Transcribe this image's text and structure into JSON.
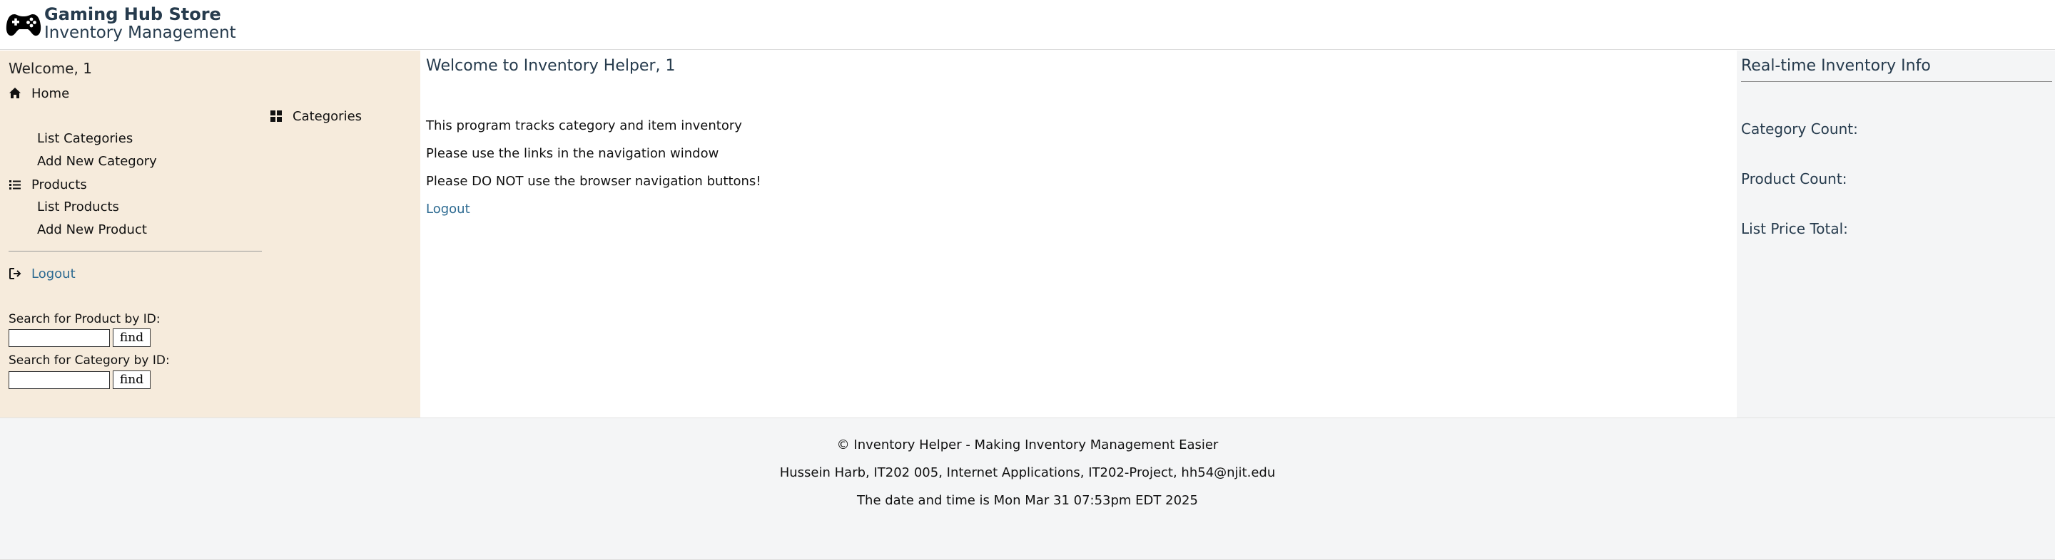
{
  "header": {
    "title": "Gaming Hub Store",
    "subtitle": "Inventory Management",
    "logo_icon": "gamepad-icon"
  },
  "sidebar": {
    "welcome": "Welcome, 1",
    "home": {
      "label": "Home",
      "icon": "home-icon"
    },
    "categories": {
      "label": "Categories",
      "icon": "grid-icon",
      "items": [
        "List Categories",
        "Add New Category"
      ]
    },
    "products": {
      "label": "Products",
      "icon": "list-icon",
      "items": [
        "List Products",
        "Add New Product"
      ]
    },
    "logout": {
      "label": "Logout",
      "icon": "logout-icon"
    },
    "search_product": {
      "label": "Search for Product by ID:",
      "value": "",
      "button": "find"
    },
    "search_category": {
      "label": "Search for Category by ID:",
      "value": "",
      "button": "find"
    }
  },
  "main": {
    "title": "Welcome to Inventory Helper, 1",
    "paragraphs": [
      "This program tracks category and item inventory",
      "Please use the links in the navigation window",
      "Please DO NOT use the browser navigation buttons!"
    ],
    "logout": "Logout"
  },
  "right_panel": {
    "title": "Real-time Inventory Info",
    "stats": [
      "Category Count:",
      "Product Count:",
      "List Price Total:"
    ]
  },
  "footer": {
    "lines": [
      "© Inventory Helper - Making Inventory Management Easier",
      "Hussein Harb, IT202 005, Internet Applications, IT202-Project, hh54@njit.edu",
      "The date and time is Mon Mar 31 07:53pm EDT 2025"
    ]
  },
  "colors": {
    "sidebar_bg": "#f6ebdc",
    "panel_bg": "#f4f5f6",
    "heading": "#263b4d",
    "link": "#2c6a91"
  }
}
